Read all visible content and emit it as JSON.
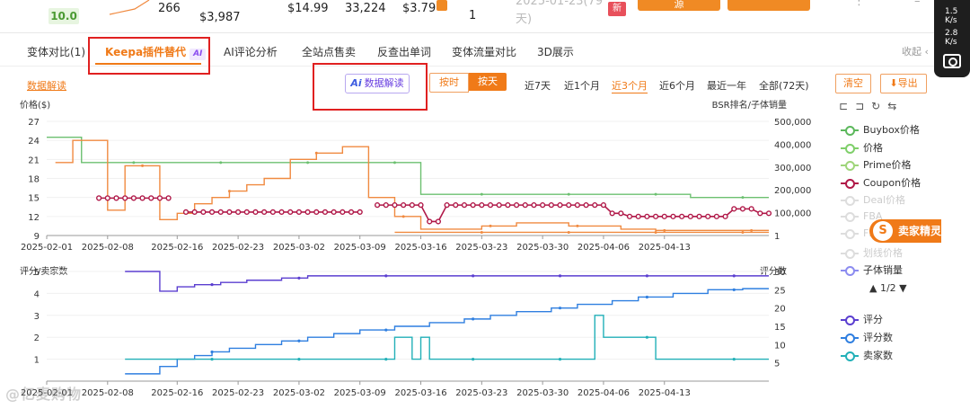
{
  "top": {
    "score": "10.0",
    "val_266": "266",
    "price_a": "$3,987",
    "price_b": "$14.99",
    "count": "33,224",
    "fee": "$3.79",
    "one": "1",
    "date_line": "2025-01-23(79",
    "days": "天)",
    "new_tag": "新",
    "btn1": "源"
  },
  "tabs": [
    "变体对比(1)",
    "Keepa插件替代",
    "AI评论分析",
    "全站点售卖",
    "反查出单词",
    "变体流量对比",
    "3D展示"
  ],
  "ai_badge": "AI",
  "collapse": "收起",
  "toolbar": {
    "explain_link": "数据解读",
    "ai_button_prefix": "Ai",
    "ai_button": "数据解读",
    "by_hour": "按时",
    "by_day": "按天",
    "ranges": [
      "近7天",
      "近1个月",
      "近3个月",
      "近6个月",
      "最近一年",
      "全部(72天)"
    ],
    "active_range": 2,
    "clear": "清空",
    "export": "导出"
  },
  "legend1": [
    {
      "label": "Buybox价格",
      "color": "#5cb85c",
      "dim": false
    },
    {
      "label": "价格",
      "color": "#7fcf6a",
      "dim": false
    },
    {
      "label": "Prime价格",
      "color": "#9fd57a",
      "dim": false
    },
    {
      "label": "Coupon价格",
      "color": "#b01848",
      "dim": false
    },
    {
      "label": "Deal价格",
      "color": "#dddddd",
      "dim": true
    },
    {
      "label": "FBA",
      "color": "#dddddd",
      "dim": true
    },
    {
      "label": "FB",
      "color": "#dddddd",
      "dim": true
    },
    {
      "label": "划线价格",
      "color": "#dddddd",
      "dim": true
    },
    {
      "label": "子体销量",
      "color": "#8c8cf0",
      "dim": false
    }
  ],
  "pager": "▲ 1/2 ▼",
  "legend2": [
    {
      "label": "评分",
      "color": "#5b3fd0"
    },
    {
      "label": "评分数",
      "color": "#2f7fe0"
    },
    {
      "label": "卖家数",
      "color": "#22b0b8"
    }
  ],
  "seller_brand": "卖家精灵",
  "watermark": "@亿麦购物",
  "rail": {
    "up": "1.5",
    "up_unit": "K/s",
    "down": "2.8",
    "down_unit": "K/s"
  },
  "chart_data": [
    {
      "type": "line",
      "ylabel": "价格($)",
      "y2label": "BSR排名/子体销量",
      "ylim": [
        9,
        27
      ],
      "yticks": [
        9,
        12,
        15,
        18,
        21,
        24,
        27
      ],
      "y2lim": [
        0,
        500000
      ],
      "y2ticks": [
        "1",
        "100,000",
        "200,000",
        "300,000",
        "400,000",
        "500,000"
      ],
      "xticks": [
        "2025-02-01",
        "2025-02-08",
        "2025-02-16",
        "2025-02-23",
        "2025-03-02",
        "2025-03-09",
        "2025-03-16",
        "2025-03-23",
        "2025-03-30",
        "2025-04-06",
        "2025-04-13"
      ],
      "series": [
        {
          "name": "Buybox价格",
          "color": "#6cc070",
          "points": [
            [
              0,
              24.5
            ],
            [
              4,
              24.5
            ],
            [
              4,
              20.5
            ],
            [
              43,
              20.5
            ],
            [
              43,
              15.5
            ],
            [
              74,
              15.5
            ],
            [
              74,
              15
            ],
            [
              83,
              15
            ]
          ]
        },
        {
          "name": "价格",
          "color": "#f08a40",
          "points": [
            [
              1,
              20.5
            ],
            [
              3,
              20.5
            ],
            [
              3,
              24
            ],
            [
              6,
              24
            ],
            [
              7,
              24
            ],
            [
              7,
              13
            ],
            [
              9,
              13
            ],
            [
              9,
              20
            ],
            [
              13,
              20
            ],
            [
              13,
              11.5
            ],
            [
              15,
              11.5
            ],
            [
              15,
              12.5
            ],
            [
              17,
              12.5
            ],
            [
              17,
              14
            ],
            [
              19,
              14
            ],
            [
              19,
              15
            ],
            [
              21,
              15
            ],
            [
              21,
              16
            ],
            [
              23,
              16
            ],
            [
              23,
              17
            ],
            [
              25,
              17
            ],
            [
              25,
              18
            ],
            [
              28,
              18
            ],
            [
              28,
              21
            ],
            [
              31,
              21
            ],
            [
              31,
              22
            ],
            [
              34,
              22
            ],
            [
              34,
              23
            ],
            [
              37,
              23
            ],
            [
              37,
              15
            ],
            [
              40,
              15
            ],
            [
              40,
              12
            ],
            [
              43,
              12
            ],
            [
              43,
              10
            ],
            [
              50,
              10
            ],
            [
              50,
              10.5
            ],
            [
              54,
              10.5
            ],
            [
              54,
              11
            ],
            [
              60,
              11
            ],
            [
              60,
              10.5
            ],
            [
              66,
              10.5
            ],
            [
              66,
              10
            ],
            [
              70,
              10
            ],
            [
              70,
              9.8
            ],
            [
              83,
              9.8
            ]
          ]
        },
        {
          "name": "Coupon价格",
          "color": "#b01848",
          "points": [
            [
              6,
              14.9
            ],
            [
              7,
              14.9
            ],
            [
              8,
              14.9
            ],
            [
              9,
              14.9
            ],
            [
              10,
              14.9
            ],
            [
              11,
              14.9
            ],
            [
              12,
              14.9
            ],
            [
              13,
              14.9
            ],
            [
              14,
              14.9
            ],
            [
              16,
              12.7
            ],
            [
              17,
              12.7
            ],
            [
              18,
              12.7
            ],
            [
              19,
              12.7
            ],
            [
              20,
              12.7
            ],
            [
              21,
              12.7
            ],
            [
              22,
              12.7
            ],
            [
              23,
              12.7
            ],
            [
              24,
              12.7
            ],
            [
              25,
              12.7
            ],
            [
              26,
              12.7
            ],
            [
              27,
              12.7
            ],
            [
              28,
              12.7
            ],
            [
              29,
              12.7
            ],
            [
              30,
              12.7
            ],
            [
              31,
              12.7
            ],
            [
              32,
              12.7
            ],
            [
              33,
              12.7
            ],
            [
              34,
              12.7
            ],
            [
              35,
              12.7
            ],
            [
              36,
              12.7
            ],
            [
              38,
              13.8
            ],
            [
              39,
              13.8
            ],
            [
              40,
              13.8
            ],
            [
              41,
              13.8
            ],
            [
              42,
              13.8
            ],
            [
              43,
              13.8
            ],
            [
              44,
              11.2
            ],
            [
              45,
              11.2
            ],
            [
              46,
              13.8
            ],
            [
              47,
              13.8
            ],
            [
              48,
              13.8
            ],
            [
              49,
              13.8
            ],
            [
              50,
              13.8
            ],
            [
              51,
              13.8
            ],
            [
              52,
              13.8
            ],
            [
              53,
              13.8
            ],
            [
              54,
              13.8
            ],
            [
              55,
              13.8
            ],
            [
              56,
              13.8
            ],
            [
              57,
              13.8
            ],
            [
              58,
              13.8
            ],
            [
              59,
              13.8
            ],
            [
              60,
              13.8
            ],
            [
              61,
              13.8
            ],
            [
              62,
              13.8
            ],
            [
              63,
              13.8
            ],
            [
              64,
              13.8
            ],
            [
              65,
              12.5
            ],
            [
              66,
              12.5
            ],
            [
              67,
              12
            ],
            [
              68,
              12
            ],
            [
              69,
              12
            ],
            [
              70,
              12
            ],
            [
              71,
              12
            ],
            [
              72,
              12
            ],
            [
              73,
              12
            ],
            [
              74,
              12
            ],
            [
              75,
              12
            ],
            [
              76,
              12
            ],
            [
              77,
              12
            ],
            [
              78,
              12
            ],
            [
              79,
              13.2
            ],
            [
              80,
              13.2
            ],
            [
              81,
              13.2
            ],
            [
              82,
              12.5
            ],
            [
              83,
              12.5
            ]
          ]
        },
        {
          "name": "子体销量",
          "color": "#f08a40",
          "points": [
            [
              40,
              9.5
            ],
            [
              83,
              9.5
            ]
          ]
        }
      ]
    },
    {
      "type": "line",
      "ylabel": "评分/卖家数",
      "y2label": "评分数",
      "ylim": [
        0,
        5
      ],
      "yticks": [
        1,
        2,
        3,
        4,
        5
      ],
      "y2lim": [
        0,
        30
      ],
      "y2ticks": [
        5,
        10,
        15,
        20,
        25,
        30
      ],
      "xticks": [
        "2025-02-01",
        "2025-02-08",
        "2025-02-16",
        "2025-02-23",
        "2025-03-02",
        "2025-03-09",
        "2025-03-16",
        "2025-03-23",
        "2025-03-30",
        "2025-04-06",
        "2025-04-13"
      ],
      "series": [
        {
          "name": "评分",
          "color": "#5b3fd0",
          "axis": "left",
          "points": [
            [
              9,
              5
            ],
            [
              13,
              5
            ],
            [
              13,
              4.1
            ],
            [
              15,
              4.1
            ],
            [
              15,
              4.3
            ],
            [
              17,
              4.3
            ],
            [
              17,
              4.4
            ],
            [
              20,
              4.4
            ],
            [
              20,
              4.5
            ],
            [
              23,
              4.5
            ],
            [
              23,
              4.6
            ],
            [
              27,
              4.6
            ],
            [
              27,
              4.7
            ],
            [
              30,
              4.7
            ],
            [
              30,
              4.8
            ],
            [
              83,
              4.8
            ]
          ]
        },
        {
          "name": "评分数",
          "color": "#2f7fe0",
          "axis": "right",
          "points": [
            [
              9,
              2
            ],
            [
              13,
              2
            ],
            [
              13,
              4
            ],
            [
              15,
              4
            ],
            [
              15,
              6
            ],
            [
              17,
              6
            ],
            [
              17,
              7
            ],
            [
              19,
              7
            ],
            [
              19,
              8
            ],
            [
              21,
              8
            ],
            [
              21,
              9
            ],
            [
              24,
              9
            ],
            [
              24,
              10
            ],
            [
              27,
              10
            ],
            [
              27,
              11
            ],
            [
              30,
              11
            ],
            [
              30,
              12
            ],
            [
              33,
              12
            ],
            [
              33,
              13
            ],
            [
              36,
              13
            ],
            [
              36,
              14
            ],
            [
              40,
              14
            ],
            [
              40,
              15
            ],
            [
              44,
              15
            ],
            [
              44,
              16
            ],
            [
              48,
              16
            ],
            [
              48,
              17
            ],
            [
              51,
              17
            ],
            [
              51,
              18
            ],
            [
              54,
              18
            ],
            [
              54,
              19
            ],
            [
              58,
              19
            ],
            [
              58,
              20
            ],
            [
              61,
              20
            ],
            [
              61,
              21
            ],
            [
              65,
              21
            ],
            [
              65,
              22
            ],
            [
              68,
              22
            ],
            [
              68,
              23
            ],
            [
              72,
              23
            ],
            [
              72,
              24
            ],
            [
              76,
              24
            ],
            [
              76,
              25
            ],
            [
              80,
              25
            ],
            [
              80,
              25.3
            ],
            [
              83,
              25.3
            ]
          ]
        },
        {
          "name": "卖家数",
          "color": "#22b0b8",
          "axis": "left",
          "points": [
            [
              9,
              1
            ],
            [
              40,
              1
            ],
            [
              40,
              2
            ],
            [
              42,
              2
            ],
            [
              42,
              1
            ],
            [
              43,
              1
            ],
            [
              43,
              2
            ],
            [
              44,
              2
            ],
            [
              44,
              1
            ],
            [
              63,
              1
            ],
            [
              63,
              3
            ],
            [
              64,
              3
            ],
            [
              64,
              2
            ],
            [
              70,
              2
            ],
            [
              70,
              1
            ],
            [
              83,
              1
            ]
          ]
        }
      ]
    }
  ]
}
